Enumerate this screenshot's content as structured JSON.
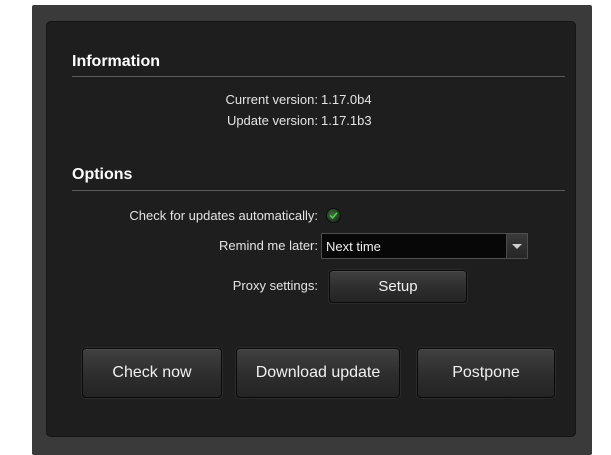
{
  "information": {
    "title": "Information",
    "current_version_label": "Current version:",
    "current_version_value": "1.17.0b4",
    "update_version_label": "Update version:",
    "update_version_value": "1.17.1b3"
  },
  "options": {
    "title": "Options",
    "auto_check_label": "Check for updates automatically:",
    "auto_check_enabled": true,
    "remind_label": "Remind me later:",
    "remind_selected": "Next time",
    "proxy_label": "Proxy settings:",
    "setup_button_label": "Setup"
  },
  "actions": {
    "check_now": "Check now",
    "download_update": "Download update",
    "postpone": "Postpone"
  },
  "colors": {
    "panel_background": "#1e1e1e",
    "window_background": "#3a3a3a",
    "text": "#e4e4e4",
    "check_green": "#44cc44"
  },
  "icons": {
    "auto_check": "check-icon",
    "dropdown": "chevron-down-icon"
  }
}
